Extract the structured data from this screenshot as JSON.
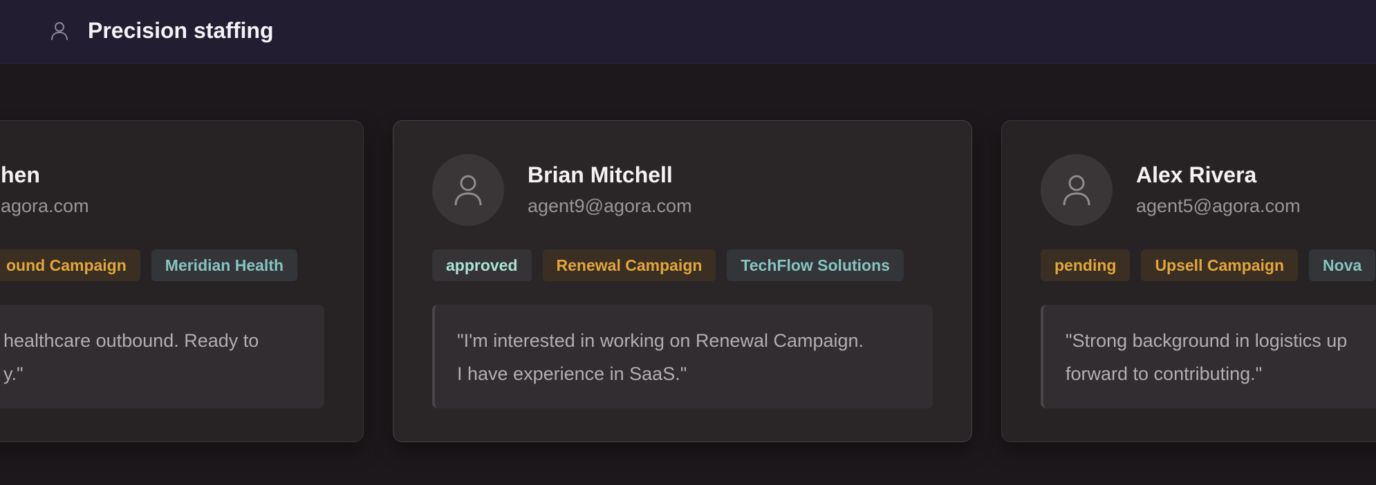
{
  "header": {
    "title": "Precision staffing",
    "icon": "user-icon"
  },
  "cards": [
    {
      "name": "hen",
      "email": "agora.com",
      "campaign": "ound Campaign",
      "client": "Meridian Health",
      "quote_line1": "healthcare outbound. Ready to",
      "quote_line2": "y.\""
    },
    {
      "name": "Brian Mitchell",
      "email": "agent9@agora.com",
      "status": "approved",
      "campaign": "Renewal Campaign",
      "client": "TechFlow Solutions",
      "quote_line1": "\"I'm interested in working on Renewal Campaign.",
      "quote_line2": "I have experience in SaaS.\""
    },
    {
      "name": "Alex Rivera",
      "email": "agent5@agora.com",
      "status": "pending",
      "campaign": "Upsell Campaign",
      "client": "Nova",
      "quote_line1": "\"Strong background in logistics up",
      "quote_line2": "forward to contributing.\""
    }
  ],
  "colors": {
    "header_bg": "#231d32",
    "page_bg": "#1c181b",
    "card_bg": "#272324",
    "approved": "#a9e3d4",
    "pending": "#e2a63b",
    "client": "#86c4bf"
  }
}
